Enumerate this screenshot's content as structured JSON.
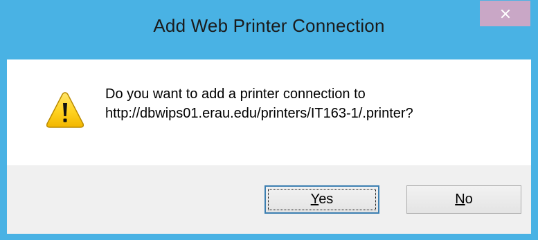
{
  "window": {
    "title": "Add Web Printer Connection",
    "close_icon": "close-icon"
  },
  "message": {
    "icon": "warning-icon",
    "line1": "Do you want to add a printer connection to",
    "line2": "http://dbwips01.erau.edu/printers/IT163-1/.printer?"
  },
  "buttons": {
    "yes": {
      "mnemonic": "Y",
      "rest": "es"
    },
    "no": {
      "mnemonic": "N",
      "rest": "o"
    }
  },
  "colors": {
    "frame": "#49b2e4",
    "close_button": "#c9a7c6",
    "footer": "#f0f0f0"
  }
}
